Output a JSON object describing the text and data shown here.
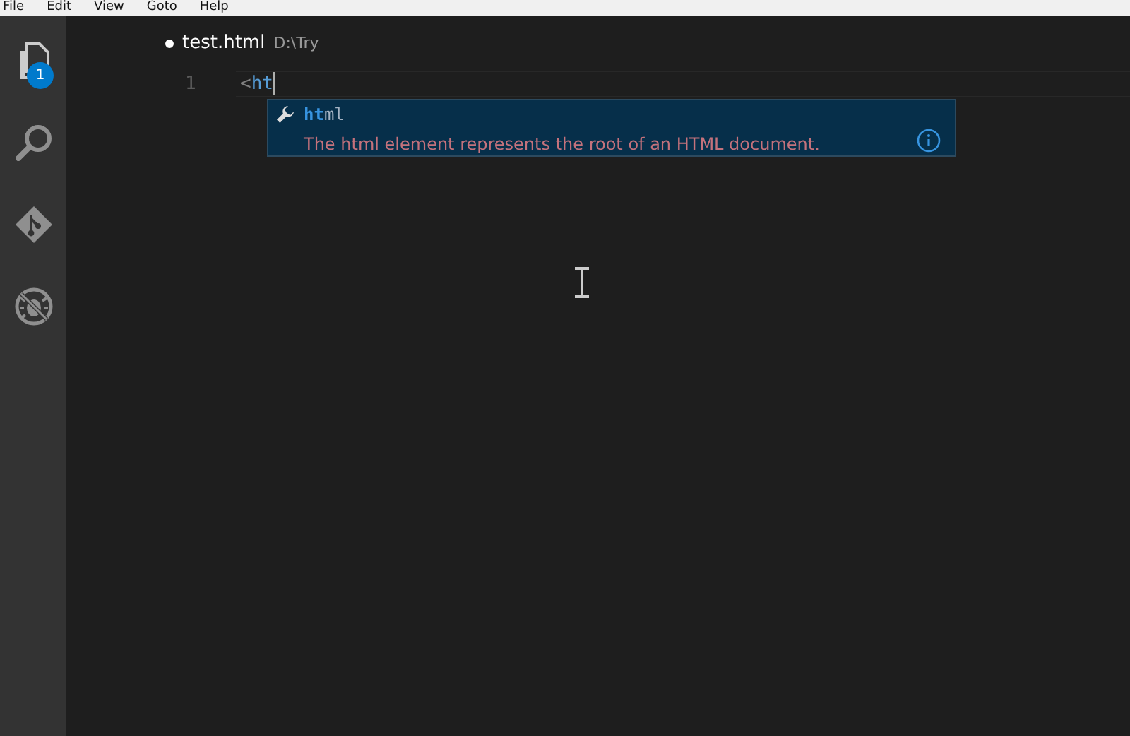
{
  "menu_bar": [
    "File",
    "Edit",
    "View",
    "Goto",
    "Help"
  ],
  "activity_bar": [
    {
      "kind": "explorer",
      "badge": "1",
      "selected": true
    },
    {
      "kind": "search",
      "selected": false
    },
    {
      "kind": "git",
      "selected": false
    },
    {
      "kind": "debug",
      "selected": false
    }
  ],
  "tab": {
    "title": "test.html",
    "path": "D:\\Try",
    "dirty": true
  },
  "editor": {
    "lines": [
      {
        "number": "1",
        "bracket": "<",
        "text": "ht"
      }
    ]
  },
  "suggestion": {
    "label_parts": [
      {
        "text": "ht",
        "matched": true
      },
      {
        "text": "ml",
        "matched": false
      }
    ],
    "description": "The html element represents the root of an HTML document."
  }
}
